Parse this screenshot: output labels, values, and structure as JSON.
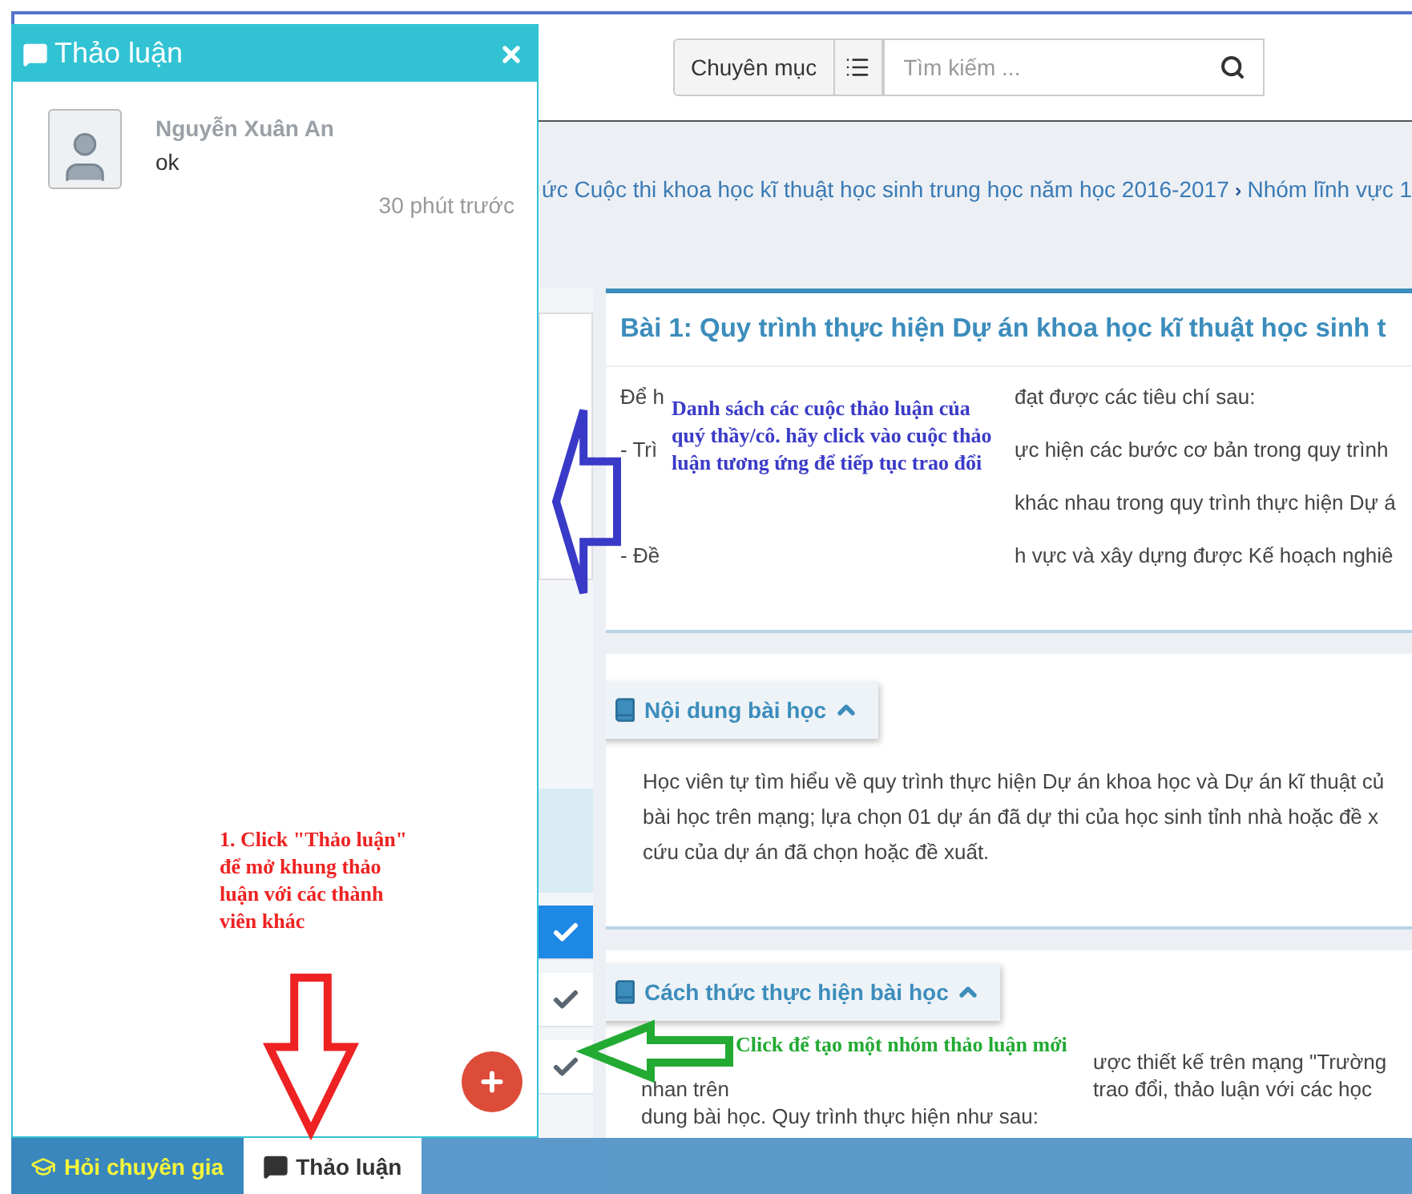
{
  "header": {
    "category_button": "Chuyên mục",
    "search": {
      "placeholder": "Tìm kiếm ..."
    }
  },
  "breadcrumb": [
    "ức Cuộc thi khoa học kĩ thuật học sinh trung học năm học 2016-2017",
    "Nhóm lĩnh vực 1"
  ],
  "lesson_steps": [
    {
      "done": true,
      "selected": true
    },
    {
      "done": true,
      "selected": false
    },
    {
      "done": true,
      "selected": false
    }
  ],
  "lesson": {
    "title": "Bài 1: Quy trình thực hiện Dự án khoa học kĩ thuật học sinh t",
    "lines": [
      {
        "left": "Để h",
        "right": "đạt được các tiêu chí sau:"
      },
      {
        "left": "- Trì",
        "right": "ực hiện các bước cơ bản trong quy trình"
      },
      {
        "right": "khác nhau trong quy trình thực hiện Dự á"
      },
      {
        "left": "- Đề",
        "right": "h vực và xây dựng được Kế hoạch nghiê"
      }
    ]
  },
  "sections": [
    {
      "title": "Nội dung bài học",
      "expanded": true,
      "lines": [
        {
          "left": "Học viên tự tìm hiểu về quy trình thực hiện Dự án khoa học và Dự án kĩ thuật củ"
        },
        {
          "left": "bài học trên mạng; lựa chọn 01 dự án đã dự thi của học sinh tỉnh nhà hoặc đề x"
        },
        {
          "left": "cứu của dự án đã chọn hoặc đề xuất."
        }
      ]
    },
    {
      "title": "Cách thức thực hiện bài học",
      "expanded": true,
      "lines": [
        {
          "right": "ược thiết kế trên mạng \"Trường"
        },
        {
          "left": "nhan trên",
          "right": "trao đổi, thảo luận với các học"
        },
        {
          "left": "dung bài học. Quy trình thực hiện như sau:"
        }
      ]
    }
  ],
  "chat_panel": {
    "title": "Thảo luận",
    "messages": [
      {
        "author": "Nguyễn Xuân An",
        "text": "ok",
        "time": "30 phút trước"
      }
    ]
  },
  "bottom_tabs": [
    {
      "label": "Hỏi chuyên gia",
      "selected": false
    },
    {
      "label": "Thảo luận",
      "selected": true
    }
  ],
  "annotations": [
    {
      "kind": "left-arrow",
      "color": "#3a3ac8",
      "text": "Danh sách các cuộc thảo luận của quý thầy/cô. hãy click vào cuộc thảo luận tương ứng để tiếp tục trao đổi"
    },
    {
      "kind": "down-arrow",
      "color": "#ee2222",
      "text": "1. Click \"Thảo luận\" để mở khung thảo luận với các thành viên khác"
    },
    {
      "kind": "left-arrow",
      "color": "#22aa33",
      "text": "Click để tạo một nhóm thảo luận mới"
    }
  ]
}
